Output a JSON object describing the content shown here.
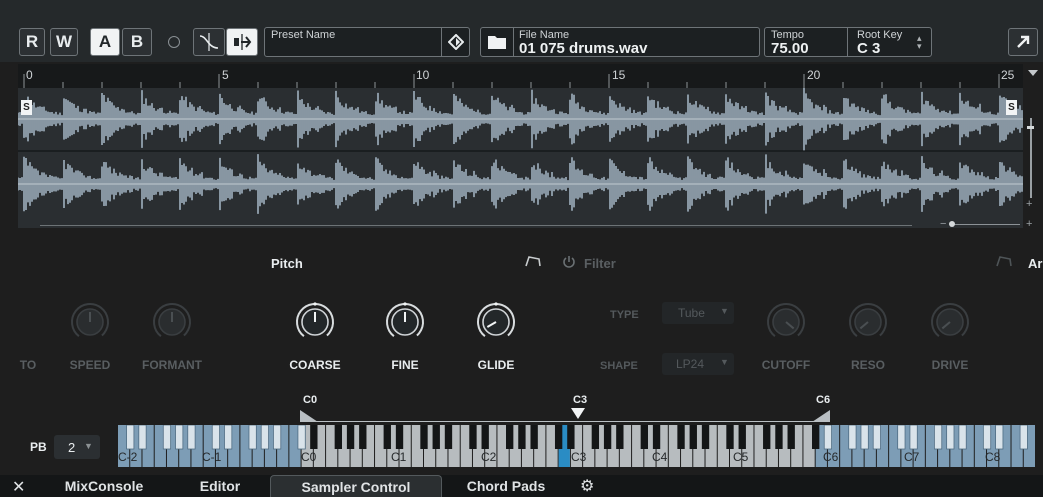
{
  "toolbar": {
    "r_label": "R",
    "w_label": "W",
    "a_label": "A",
    "b_label": "B",
    "preset_label": "Preset Name",
    "file_label": "File Name",
    "file_value": "01 075 drums.wav",
    "tempo_label": "Tempo",
    "tempo_value": "75.00",
    "rootkey_label": "Root Key",
    "rootkey_value": "C 3"
  },
  "ruler": {
    "ticks": [
      "0",
      "5",
      "10",
      "15",
      "20",
      "25"
    ]
  },
  "markers": {
    "start": "S",
    "end": "S"
  },
  "sections": {
    "pitch": "Pitch",
    "filter": "Filter",
    "amp": "Ar"
  },
  "knobs": {
    "to": "TO",
    "speed": "SPEED",
    "formant": "FORMANT",
    "coarse": "COARSE",
    "fine": "FINE",
    "glide": "GLIDE",
    "cutoff": "CUTOFF",
    "reso": "RESO",
    "drive": "DRIVE"
  },
  "filter": {
    "type_label": "TYPE",
    "type_value": "Tube",
    "shape_label": "SHAPE",
    "shape_value": "LP24"
  },
  "keyboard": {
    "pb_label": "PB",
    "pb_value": "2",
    "range_low": "C0",
    "root": "C3",
    "range_high": "C6",
    "octaves": [
      "C-2",
      "C-1",
      "C0",
      "C1",
      "C2",
      "C3",
      "C4",
      "C5",
      "C6",
      "C7",
      "C8"
    ]
  },
  "tabs": {
    "mixconsole": "MixConsole",
    "editor": "Editor",
    "sampler": "Sampler Control",
    "chordpads": "Chord Pads"
  },
  "colors": {
    "accent": "#2a8cc4",
    "wave": "#9fb0bf"
  }
}
